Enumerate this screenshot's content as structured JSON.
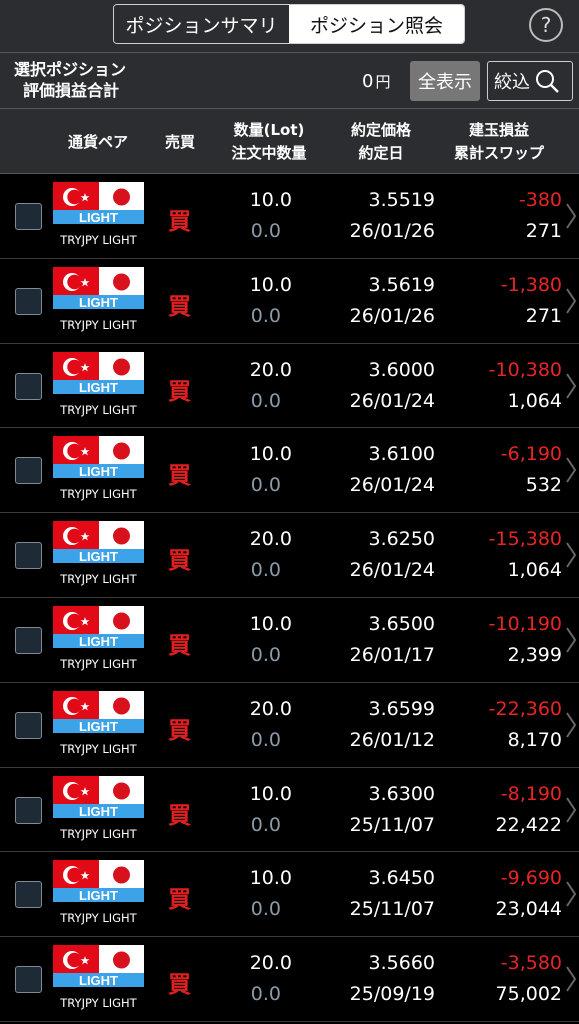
{
  "tabs": [
    {
      "label": "ポジションサマリ",
      "active": false
    },
    {
      "label": "ポジション照会",
      "active": true
    }
  ],
  "help": {
    "label": "?"
  },
  "summary": {
    "label_line1": "選択ポジション",
    "label_line2": "評価損益合計",
    "value": "0",
    "unit": "円",
    "show_all_label": "全表示",
    "filter_label": "絞込"
  },
  "columns": {
    "pair": "通貨ペア",
    "side": "売買",
    "qty_line1": "数量(Lot)",
    "qty_line2": "注文中数量",
    "price_line1": "約定価格",
    "price_line2": "約定日",
    "pl_line1": "建玉損益",
    "pl_line2": "累計スワップ"
  },
  "flag_text": "LIGHT",
  "colors": {
    "loss": "#e82424",
    "side_buy": "#e02020",
    "turkey_red": "#e30a17",
    "light_blue": "#3da3e8"
  },
  "positions": [
    {
      "pair": "TRYJPY LIGHT",
      "side": "買",
      "qty": "10.0",
      "ordered": "0.0",
      "price": "3.5519",
      "date": "26/01/26",
      "pl": "-380",
      "swap": "271"
    },
    {
      "pair": "TRYJPY LIGHT",
      "side": "買",
      "qty": "10.0",
      "ordered": "0.0",
      "price": "3.5619",
      "date": "26/01/26",
      "pl": "-1,380",
      "swap": "271"
    },
    {
      "pair": "TRYJPY LIGHT",
      "side": "買",
      "qty": "20.0",
      "ordered": "0.0",
      "price": "3.6000",
      "date": "26/01/24",
      "pl": "-10,380",
      "swap": "1,064"
    },
    {
      "pair": "TRYJPY LIGHT",
      "side": "買",
      "qty": "10.0",
      "ordered": "0.0",
      "price": "3.6100",
      "date": "26/01/24",
      "pl": "-6,190",
      "swap": "532"
    },
    {
      "pair": "TRYJPY LIGHT",
      "side": "買",
      "qty": "20.0",
      "ordered": "0.0",
      "price": "3.6250",
      "date": "26/01/24",
      "pl": "-15,380",
      "swap": "1,064"
    },
    {
      "pair": "TRYJPY LIGHT",
      "side": "買",
      "qty": "10.0",
      "ordered": "0.0",
      "price": "3.6500",
      "date": "26/01/17",
      "pl": "-10,190",
      "swap": "2,399"
    },
    {
      "pair": "TRYJPY LIGHT",
      "side": "買",
      "qty": "20.0",
      "ordered": "0.0",
      "price": "3.6599",
      "date": "26/01/12",
      "pl": "-22,360",
      "swap": "8,170"
    },
    {
      "pair": "TRYJPY LIGHT",
      "side": "買",
      "qty": "10.0",
      "ordered": "0.0",
      "price": "3.6300",
      "date": "25/11/07",
      "pl": "-8,190",
      "swap": "22,422"
    },
    {
      "pair": "TRYJPY LIGHT",
      "side": "買",
      "qty": "10.0",
      "ordered": "0.0",
      "price": "3.6450",
      "date": "25/11/07",
      "pl": "-9,690",
      "swap": "23,044"
    },
    {
      "pair": "TRYJPY LIGHT",
      "side": "買",
      "qty": "20.0",
      "ordered": "0.0",
      "price": "3.5660",
      "date": "25/09/19",
      "pl": "-3,580",
      "swap": "75,002"
    }
  ]
}
